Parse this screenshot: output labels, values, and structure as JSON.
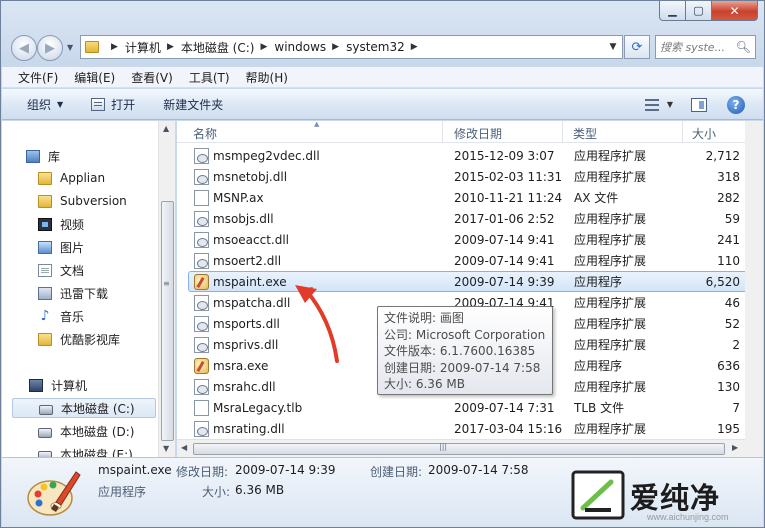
{
  "window": {
    "minimize_glyph": "▁",
    "maximize_glyph": "▢",
    "close_glyph": "✕"
  },
  "address": {
    "crumbs": [
      "计算机",
      "本地磁盘 (C:)",
      "windows",
      "system32"
    ],
    "search_placeholder": "搜索 syste..."
  },
  "menu": [
    "文件(F)",
    "编辑(E)",
    "查看(V)",
    "工具(T)",
    "帮助(H)"
  ],
  "toolbar": {
    "organize": "组织",
    "open": "打开",
    "new_folder": "新建文件夹"
  },
  "sidebar": {
    "items": [
      {
        "label": "库",
        "icon": "library-icon"
      },
      {
        "label": "Applian",
        "icon": "folder-icon"
      },
      {
        "label": "Subversion",
        "icon": "folder-icon"
      },
      {
        "label": "视频",
        "icon": "video-icon"
      },
      {
        "label": "图片",
        "icon": "picture-icon"
      },
      {
        "label": "文档",
        "icon": "document-icon"
      },
      {
        "label": "迅雷下载",
        "icon": "download-icon"
      },
      {
        "label": "音乐",
        "icon": "music-icon"
      },
      {
        "label": "优酷影视库",
        "icon": "folder-icon"
      },
      {
        "label": "计算机",
        "icon": "computer-icon"
      },
      {
        "label": "本地磁盘 (C:)",
        "icon": "drive-icon"
      },
      {
        "label": "本地磁盘 (D:)",
        "icon": "drive-icon"
      },
      {
        "label": "本地磁盘 (E:)",
        "icon": "drive-icon"
      }
    ]
  },
  "columns": {
    "name": "名称",
    "date": "修改日期",
    "type": "类型",
    "size": "大小"
  },
  "files": [
    {
      "name": "msmpeg2vdec.dll",
      "date": "2015-12-09 3:07",
      "type": "应用程序扩展",
      "size": "2,712",
      "icon": "dll"
    },
    {
      "name": "msnetobj.dll",
      "date": "2015-02-03 11:31",
      "type": "应用程序扩展",
      "size": "318",
      "icon": "dll"
    },
    {
      "name": "MSNP.ax",
      "date": "2010-11-21 11:24",
      "type": "AX 文件",
      "size": "282",
      "icon": "file"
    },
    {
      "name": "msobjs.dll",
      "date": "2017-01-06 2:52",
      "type": "应用程序扩展",
      "size": "59",
      "icon": "dll"
    },
    {
      "name": "msoeacct.dll",
      "date": "2009-07-14 9:41",
      "type": "应用程序扩展",
      "size": "241",
      "icon": "dll"
    },
    {
      "name": "msoert2.dll",
      "date": "2009-07-14 9:41",
      "type": "应用程序扩展",
      "size": "110",
      "icon": "dll"
    },
    {
      "name": "mspaint.exe",
      "date": "2009-07-14 9:39",
      "type": "应用程序",
      "size": "6,520",
      "icon": "exe"
    },
    {
      "name": "mspatcha.dll",
      "date": "2009-07-14 9:41",
      "type": "应用程序扩展",
      "size": "46",
      "icon": "dll"
    },
    {
      "name": "msports.dll",
      "date": "",
      "type": "应用程序扩展",
      "size": "52",
      "icon": "dll"
    },
    {
      "name": "msprivs.dll",
      "date": "",
      "type": "应用程序扩展",
      "size": "2",
      "icon": "dll"
    },
    {
      "name": "msra.exe",
      "date": "",
      "type": "应用程序",
      "size": "636",
      "icon": "exe"
    },
    {
      "name": "msrahc.dll",
      "date": "",
      "type": "应用程序扩展",
      "size": "130",
      "icon": "dll"
    },
    {
      "name": "MsraLegacy.tlb",
      "date": "2009-07-14 7:31",
      "type": "TLB 文件",
      "size": "7",
      "icon": "file"
    },
    {
      "name": "msrating.dll",
      "date": "2017-03-04 15:16",
      "type": "应用程序扩展",
      "size": "195",
      "icon": "dll"
    }
  ],
  "selected_index": 6,
  "tooltip": {
    "lines": [
      "文件说明: 画图",
      "公司: Microsoft Corporation",
      "文件版本: 6.1.7600.16385",
      "创建日期: 2009-07-14 7:58",
      "大小: 6.36 MB"
    ]
  },
  "details": {
    "filename": "mspaint.exe",
    "modified_label": "修改日期:",
    "modified_value": "2009-07-14 9:39",
    "created_label": "创建日期:",
    "created_value": "2009-07-14 7:58",
    "type": "应用程序",
    "size_label": "大小:",
    "size_value": "6.36 MB"
  },
  "watermark": {
    "text": "爱纯净",
    "url": "www.aichunjing.com"
  }
}
